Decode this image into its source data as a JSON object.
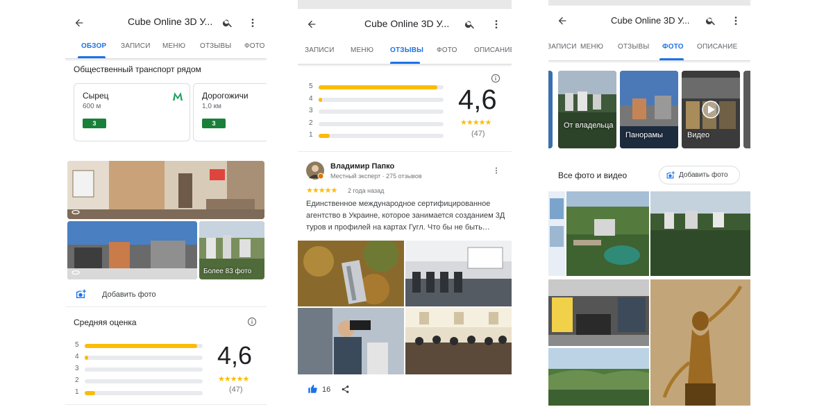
{
  "colors": {
    "accent": "#1a73e8",
    "star": "#fbbc04",
    "metro": "#18a35a",
    "badge": "#188038"
  },
  "screen1": {
    "title": "Cube Online 3D У...",
    "tabs": [
      "ОБЗОР",
      "ЗАПИСИ",
      "МЕНЮ",
      "ОТЗЫВЫ",
      "ФОТО"
    ],
    "active_tab": "ОБЗОР",
    "transit_title": "Общественный транспорт рядом",
    "stations": [
      {
        "name": "Сырец",
        "distance": "600 м",
        "line": "3"
      },
      {
        "name": "Дорогожичи",
        "distance": "1,0 км",
        "line": "3"
      }
    ],
    "more_photos": "Более 83 фото",
    "add_photo": "Добавить фото",
    "avg_rating_title": "Средняя оценка",
    "rating": "4,6",
    "stars": "★★★★★",
    "review_count": "(47)",
    "distribution": [
      {
        "label": "5",
        "fraction": 0.95
      },
      {
        "label": "4",
        "fraction": 0.02
      },
      {
        "label": "3",
        "fraction": 0
      },
      {
        "label": "2",
        "fraction": 0
      },
      {
        "label": "1",
        "fraction": 0.09
      }
    ]
  },
  "screen2": {
    "title": "Cube Online 3D У...",
    "tabs": [
      "ЗАПИСИ",
      "МЕНЮ",
      "ОТЗЫВЫ",
      "ФОТО",
      "ОПИСАНИЕ"
    ],
    "active_tab": "ОТЗЫВЫ",
    "rating": "4,6",
    "stars": "★★★★★",
    "review_count": "(47)",
    "distribution": [
      {
        "label": "5",
        "fraction": 0.95
      },
      {
        "label": "4",
        "fraction": 0.02
      },
      {
        "label": "3",
        "fraction": 0
      },
      {
        "label": "2",
        "fraction": 0
      },
      {
        "label": "1",
        "fraction": 0.09
      }
    ],
    "review": {
      "author": "Владимир Папко",
      "subtitle": "Местный эксперт · 275 отзывов",
      "stars": "★★★★★",
      "time": "2 года назад",
      "text": "Единственное международное сертифицированное агентство в Украине, которое занимается созданием 3Д туров и профилей на картах Гугл. Что бы не быть…",
      "likes": "16"
    }
  },
  "screen3": {
    "title": "Cube Online 3D У...",
    "tabs": [
      "ЗАПИСИ",
      "МЕНЮ",
      "ОТЗЫВЫ",
      "ФОТО",
      "ОПИСАНИЕ"
    ],
    "active_tab": "ФОТО",
    "categories": [
      "От владельца",
      "Панорамы",
      "Видео"
    ],
    "all_photos_title": "Все фото и видео",
    "add_photo": "Добавить фото"
  }
}
